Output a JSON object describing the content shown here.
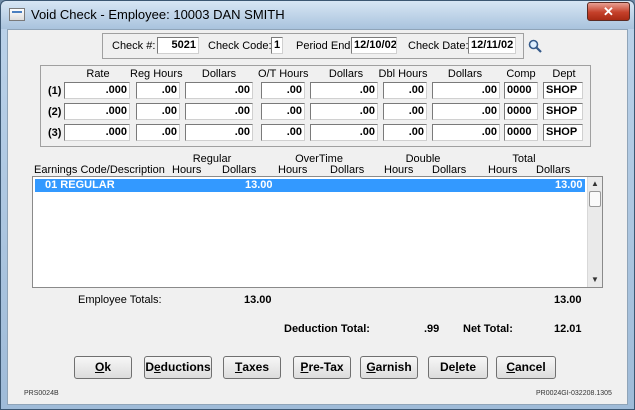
{
  "window": {
    "title": "Void Check - Employee: 10003 DAN SMITH",
    "close_glyph": "✕"
  },
  "check": {
    "check_no_label": "Check #:",
    "check_no": "5021",
    "check_code_label": "Check Code:",
    "check_code": "1",
    "period_end_label": "Period End:",
    "period_end": "12/10/02",
    "check_date_label": "Check Date:",
    "check_date": "12/11/02",
    "lookup_icon": "magnifier-icon"
  },
  "rates": {
    "headers": [
      "Rate",
      "Reg Hours",
      "Dollars",
      "O/T Hours",
      "Dollars",
      "Dbl Hours",
      "Dollars",
      "Comp",
      "Dept"
    ],
    "rows": [
      {
        "label": "(1)",
        "cells": [
          ".000",
          ".00",
          ".00",
          ".00",
          ".00",
          ".00",
          ".00",
          "0000",
          "SHOP"
        ]
      },
      {
        "label": "(2)",
        "cells": [
          ".000",
          ".00",
          ".00",
          ".00",
          ".00",
          ".00",
          ".00",
          "0000",
          "SHOP"
        ]
      },
      {
        "label": "(3)",
        "cells": [
          ".000",
          ".00",
          ".00",
          ".00",
          ".00",
          ".00",
          ".00",
          "0000",
          "SHOP"
        ]
      }
    ]
  },
  "earnings": {
    "group_headers": [
      "Regular",
      "OverTime",
      "Double",
      "Total"
    ],
    "col_headers": [
      "Earnings Code/Description",
      "Hours",
      "Dollars",
      "Hours",
      "Dollars",
      "Hours",
      "Dollars",
      "Hours",
      "Dollars"
    ],
    "rows": [
      {
        "desc": "01 REGULAR",
        "reg_hours": "",
        "reg_dollars": "13.00",
        "ot_hours": "",
        "ot_dollars": "",
        "dbl_hours": "",
        "dbl_dollars": "",
        "tot_hours": "",
        "tot_dollars": "13.00"
      }
    ]
  },
  "totals": {
    "employee_totals_label": "Employee Totals:",
    "reg_dollars": "13.00",
    "tot_dollars": "13.00",
    "deduction_total_label": "Deduction Total:",
    "deduction_total": ".99",
    "net_total_label": "Net Total:",
    "net_total": "12.01"
  },
  "buttons": {
    "ok": {
      "pre": "",
      "key": "O",
      "post": "k"
    },
    "deductions": {
      "pre": "D",
      "key": "e",
      "post": "ductions"
    },
    "taxes": {
      "pre": "",
      "key": "T",
      "post": "axes"
    },
    "pretax": {
      "pre": "",
      "key": "P",
      "post": "re-Tax"
    },
    "garnish": {
      "pre": "",
      "key": "G",
      "post": "arnish"
    },
    "delete": {
      "pre": "De",
      "key": "l",
      "post": "ete"
    },
    "cancel": {
      "pre": "",
      "key": "C",
      "post": "ancel"
    }
  },
  "footer": {
    "left": "PRS0024B",
    "right": "PR0024GI-032208.1305"
  }
}
